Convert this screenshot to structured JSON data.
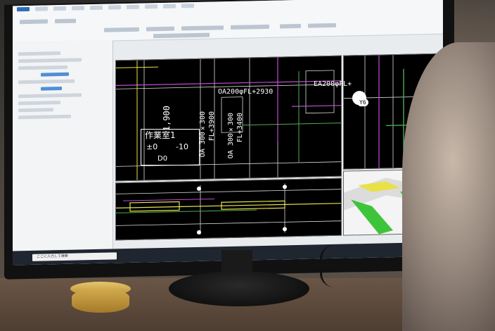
{
  "cad": {
    "room_name": "作業室1",
    "dim_left": "±0",
    "dim_right": "-10",
    "room_code": "D0",
    "dim_vertical": "1,900",
    "duct_oa": "OA200φFL+2930",
    "duct_ea": "EA200φFL+",
    "oa_size_1": "OA 300×300",
    "oa_fl_1": "FL+3900",
    "oa_size_2": "OA 300×300",
    "oa_fl_2": "FL+3400",
    "right_label": "Y6"
  },
  "taskbar": {
    "search_placeholder": "ここに入力して検索"
  }
}
